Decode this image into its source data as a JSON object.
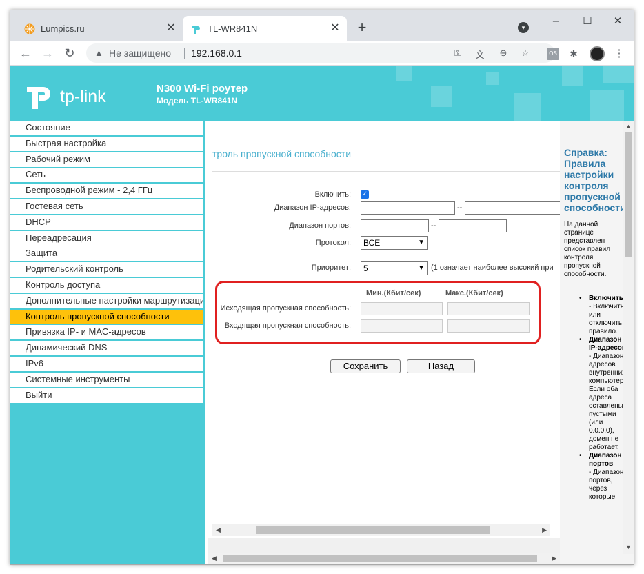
{
  "browser": {
    "tabs": [
      {
        "title": "Lumpics.ru",
        "active": false
      },
      {
        "title": "TL-WR841N",
        "active": true
      }
    ],
    "security_label": "Не защищено",
    "url": "192.168.0.1",
    "colors": {
      "tabstrip": "#dee1e6",
      "lumpics_favicon": "#f29c1f",
      "tplink_favicon": "#4acbd6"
    }
  },
  "router": {
    "logo_text": "tp-link",
    "model_title": "N300 Wi-Fi роутер",
    "model_subtitle": "Модель TL-WR841N",
    "accent_color": "#4acbd6",
    "menu": [
      {
        "label": "Состояние"
      },
      {
        "label": "Быстрая настройка"
      },
      {
        "label": "Рабочий режим"
      },
      {
        "label": "Сеть"
      },
      {
        "label": "Беспроводной режим - 2,4 ГГц"
      },
      {
        "label": "Гостевая сеть"
      },
      {
        "label": "DHCP"
      },
      {
        "label": "Переадресация"
      },
      {
        "label": "Защита"
      },
      {
        "label": "Родительский контроль"
      },
      {
        "label": "Контроль доступа"
      },
      {
        "label": "Дополнительные настройки маршрутизации"
      },
      {
        "label": "Контроль пропускной способности",
        "active": true
      },
      {
        "label": "Привязка IP- и MAC-адресов"
      },
      {
        "label": "Динамический DNS"
      },
      {
        "label": "IPv6"
      },
      {
        "label": "Системные инструменты"
      },
      {
        "label": "Выйти"
      }
    ],
    "form": {
      "title": "троль пропускной способности",
      "enable_label": "Включить:",
      "enable_checked": true,
      "ip_range_label": "Диапазон IP-адресов:",
      "port_range_label": "Диапазон портов:",
      "protocol_label": "Протокол:",
      "protocol_value": "ВСЕ",
      "priority_label": "Приоритет:",
      "priority_value": "5",
      "priority_hint": "(1 означает наиболее высокий при",
      "range_sep": "--",
      "col_min": "Мин.(Кбит/сек)",
      "col_max": "Макс.(Кбит/сек)",
      "egress_label": "Исходящая пропускная способность:",
      "ingress_label": "Входящая пропускная способность:",
      "save_button": "Сохранить",
      "back_button": "Назад"
    },
    "help": {
      "title": "Справка: Правила настройки контроля пропускной способности",
      "intro": "На данной странице представлен список правил контроля пропускной способности.",
      "items": [
        {
          "term": "Включить",
          "text": "- Включить или отключить правило."
        },
        {
          "term": "Диапазон IP-адресов",
          "text": "- Диапазон адресов внутренних компьютеров. Если оба адреса оставлены пустыми (или 0.0.0.0), домен не работает."
        },
        {
          "term": "Диапазон портов",
          "text": "- Диапазон портов, через которые"
        }
      ]
    }
  }
}
